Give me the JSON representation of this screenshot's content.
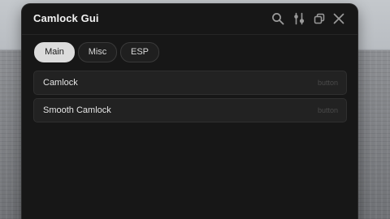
{
  "window": {
    "title": "Camlock Gui"
  },
  "titlebar_icons": [
    "search-icon",
    "sliders-icon",
    "minimize-icon",
    "close-icon"
  ],
  "tabs": [
    {
      "label": "Main",
      "active": true
    },
    {
      "label": "Misc",
      "active": false
    },
    {
      "label": "ESP",
      "active": false
    }
  ],
  "elements": [
    {
      "label": "Camlock",
      "kind": "button"
    },
    {
      "label": "Smooth Camlock",
      "kind": "button"
    }
  ],
  "colors": {
    "window_bg": "#171717",
    "row_bg": "#222222",
    "active_tab_bg": "#dcdcdc",
    "text": "#e6e6e6"
  }
}
